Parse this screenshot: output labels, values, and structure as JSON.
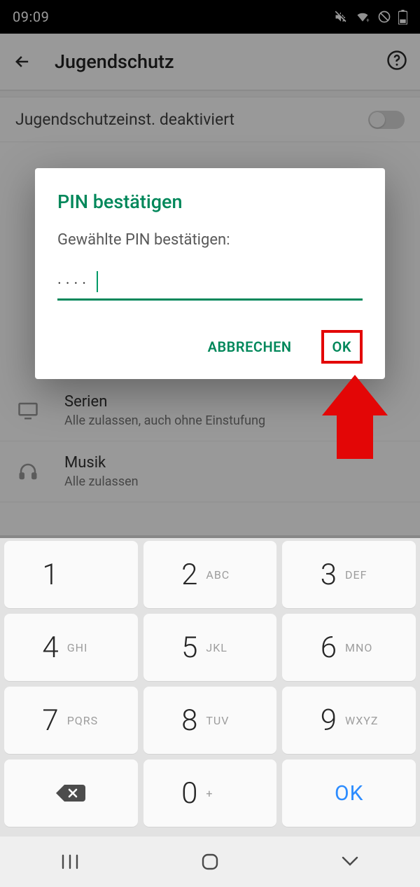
{
  "status": {
    "time": "09:09"
  },
  "header": {
    "title": "Jugendschutz"
  },
  "toggle_row": {
    "label": "Jugendschutzeinst. deaktiviert"
  },
  "rows": {
    "serien": {
      "title": "Serien",
      "sub": "Alle zulassen, auch ohne Einstufung"
    },
    "musik": {
      "title": "Musik",
      "sub": "Alle zulassen"
    }
  },
  "dialog": {
    "title": "PIN bestätigen",
    "subtitle": "Gewählte PIN bestätigen:",
    "pin_mask": "····",
    "cancel": "ABBRECHEN",
    "ok": "OK"
  },
  "keypad": {
    "k1": "1",
    "k2": "2",
    "k3": "3",
    "k4": "4",
    "k5": "5",
    "k6": "6",
    "k7": "7",
    "k8": "8",
    "k9": "9",
    "k0": "0",
    "l2": "ABC",
    "l3": "DEF",
    "l4": "GHI",
    "l5": "JKL",
    "l6": "MNO",
    "l7": "PQRS",
    "l8": "TUV",
    "l9": "WXYZ",
    "l0": "+",
    "ok": "OK"
  }
}
